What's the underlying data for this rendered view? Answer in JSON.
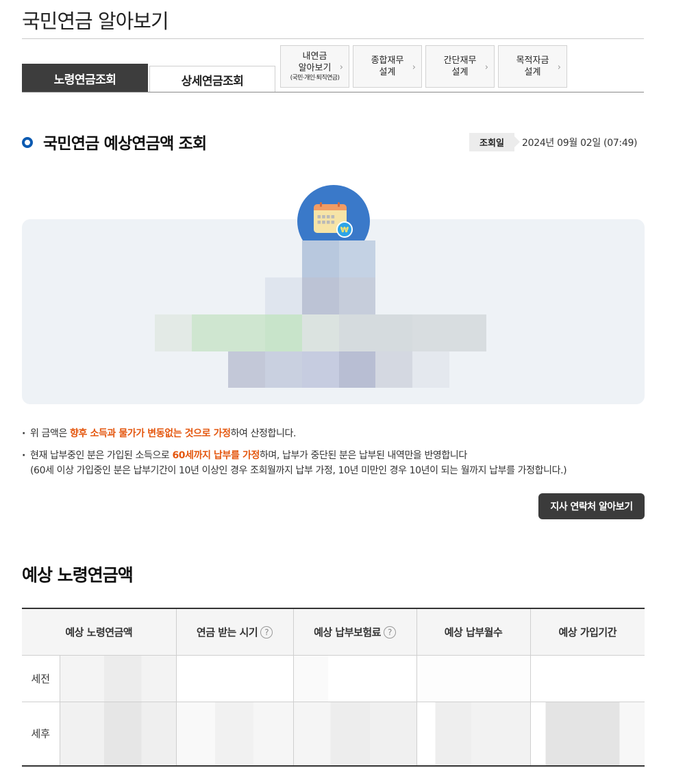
{
  "page": {
    "title": "국민연금 알아보기"
  },
  "tabs": [
    {
      "label": "노령연금조회",
      "active": true
    },
    {
      "label": "상세연금조회",
      "active": false
    }
  ],
  "link_buttons": [
    {
      "line1": "내연금",
      "line2": "알아보기",
      "sub": "(국민·개인·퇴직연금)"
    },
    {
      "line1": "종합재무",
      "line2": "설계"
    },
    {
      "line1": "간단재무",
      "line2": "설계"
    },
    {
      "line1": "목적자금",
      "line2": "설계"
    }
  ],
  "section": {
    "title": "국민연금 예상연금액 조회",
    "date_label": "조회일",
    "date_value": "2024년 09월 02일 (07:49)"
  },
  "notes": {
    "n1_pre": "위 금액은 ",
    "n1_hl": "향후 소득과 물가가 변동없는 것으로 가정",
    "n1_post": "하여 산정합니다.",
    "n2_pre": "현재 납부중인 분은 가입된 소득으로 ",
    "n2_hl": "60세까지 납부를 가정",
    "n2_post": "하며, 납부가 중단된 분은 납부된 내역만을 반영합니다",
    "n2_sub": "(60세 이상 가입중인 분은 납부기간이 10년 이상인 경우 조회월까지 납부 가정, 10년 미만인 경우 10년이 되는 월까지 납부를 가정합니다.)"
  },
  "branch_button": {
    "label": "지사 연락처 알아보기"
  },
  "pension_table": {
    "title": "예상 노령연금액",
    "headers": [
      "예상 노령연금액",
      "연금 받는 시기",
      "예상 납부보험료",
      "예상 납부월수",
      "예상 가입기간"
    ],
    "help_icon": "?",
    "rows": [
      {
        "label": "세전"
      },
      {
        "label": "세후"
      }
    ]
  },
  "colors": {
    "accent_blue": "#0b5ab1",
    "highlight_orange": "#e4570f",
    "tab_dark": "#3d3d3d"
  },
  "icons": [
    "calendar-icon",
    "coin-bag-icon",
    "chevron-right-icon",
    "help-circle-icon"
  ]
}
